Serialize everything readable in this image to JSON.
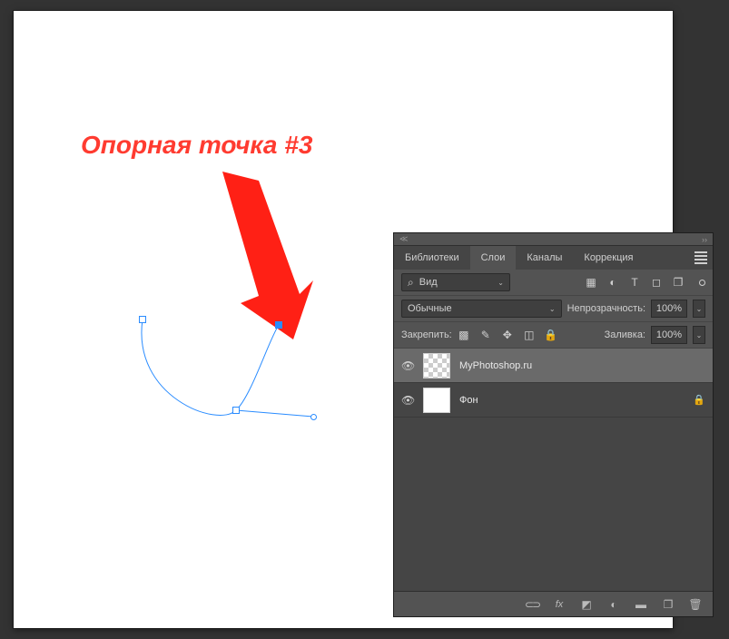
{
  "annotation": {
    "text": "Опорная точка #3",
    "color": "#ff3b30"
  },
  "panel": {
    "tabs": {
      "libraries": "Библиотеки",
      "layers": "Слои",
      "channels": "Каналы",
      "adjustments": "Коррекция"
    },
    "filter": {
      "kind_label": "Вид",
      "icons": [
        "image-filter",
        "adjustment-filter",
        "text-filter",
        "shape-filter",
        "smartobject-filter"
      ]
    },
    "blend": {
      "mode_label": "Обычные",
      "opacity_label": "Непрозрачность:",
      "opacity_value": "100%"
    },
    "lock": {
      "label": "Закрепить:",
      "fill_label": "Заливка:",
      "fill_value": "100%"
    },
    "layers": [
      {
        "name": "MyPhotoshop.ru",
        "visible": true,
        "selected": true,
        "locked": false,
        "thumb": "transparent"
      },
      {
        "name": "Фон",
        "visible": true,
        "selected": false,
        "locked": true,
        "thumb": "white"
      }
    ],
    "footer_icons": [
      "link",
      "fx",
      "mask",
      "adjustment",
      "group",
      "new-layer",
      "trash"
    ]
  }
}
